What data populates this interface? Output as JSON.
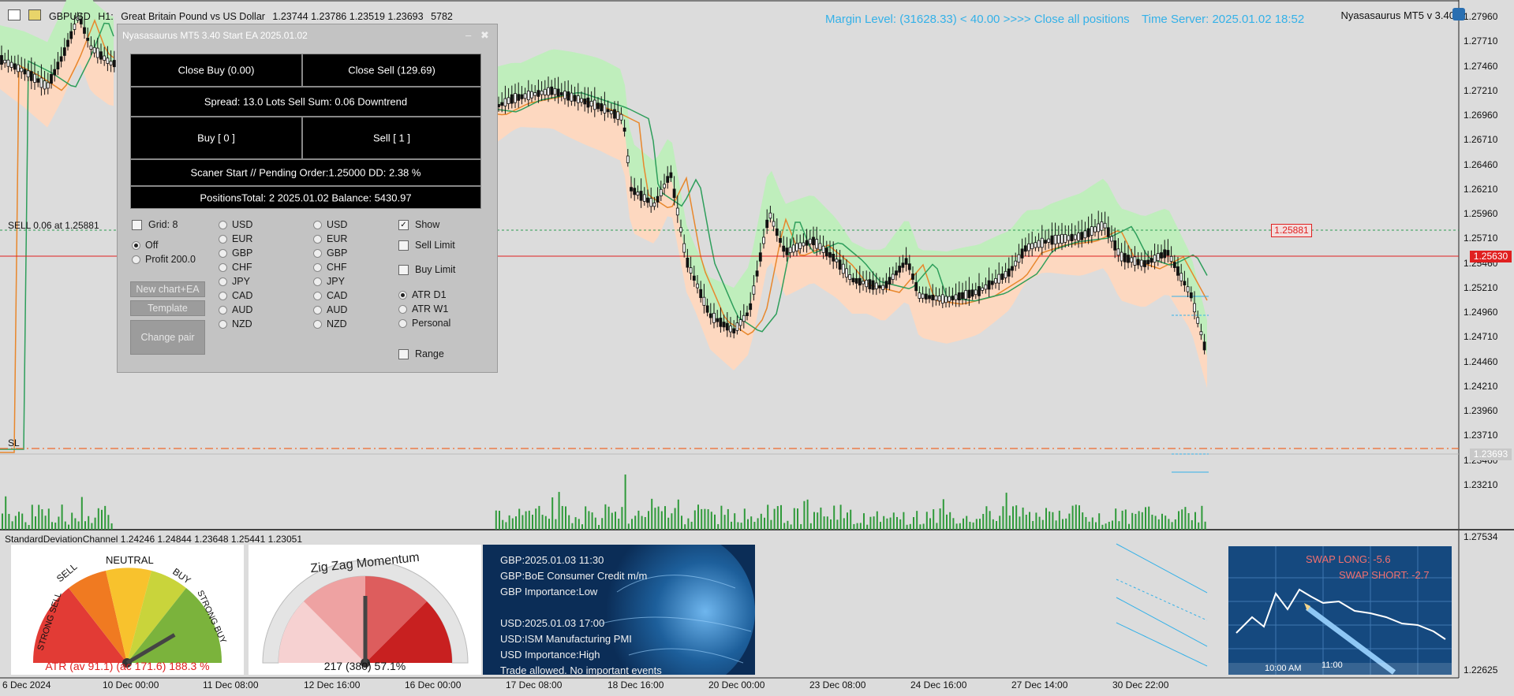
{
  "header": {
    "symbol": "GBPUSD",
    "timeframe": "H1:",
    "description": "Great Britain Pound vs US Dollar",
    "prices": "1.23744 1.23786 1.23519 1.23693",
    "tick_volume": "5782",
    "margin_text": "Margin Level: (31628.33) < 40.00 >>>> Close all positions",
    "time_server": "Time Server: 2025.01.02 18:52",
    "version": "Nyasasaurus MT5 v 3.40"
  },
  "price_axis": [
    "1.27960",
    "1.27710",
    "1.27460",
    "1.27210",
    "1.26960",
    "1.26710",
    "1.26460",
    "1.26210",
    "1.25960",
    "1.25710",
    "1.25460",
    "1.25210",
    "1.24960",
    "1.24710",
    "1.24460",
    "1.24210",
    "1.23960",
    "1.23710",
    "1.23460",
    "1.23210"
  ],
  "price_tags": {
    "sell_entry": "1.25881",
    "current_line": "1.25630",
    "bid": "1.23693"
  },
  "subwindow_axis": {
    "top": "1.27534",
    "bottom": "1.22625"
  },
  "date_axis": [
    "6 Dec 2024",
    "10 Dec 00:00",
    "11 Dec 08:00",
    "12 Dec 16:00",
    "16 Dec 00:00",
    "17 Dec 08:00",
    "18 Dec 16:00",
    "20 Dec 00:00",
    "23 Dec 08:00",
    "24 Dec 16:00",
    "27 Dec 14:00",
    "30 Dec 22:00"
  ],
  "chart_labels": {
    "sell_line": "SELL 0.06 at 1.25881",
    "sl_line": "SL"
  },
  "panel": {
    "title": "Nyasasaurus MT5 3.40  Start EA  2025.01.02",
    "minimize": "–",
    "close": "✖",
    "close_buy": "Close Buy (0.00)",
    "close_sell": "Close Sell (129.69)",
    "spread": "Spread: 13.0 Lots Sell Sum: 0.06 Downtrend",
    "buy": "Buy [ 0 ]",
    "sell": "Sell [ 1 ]",
    "scanner": "Scaner Start // Pending Order:1.25000 DD: 2.38 %",
    "positions": "PositionsTotal: 2   2025.01.02   Balance: 5430.97",
    "grid": "Grid: 8",
    "off": "Off",
    "profit": "Profit 200.0",
    "currencies_a": [
      "USD",
      "EUR",
      "GBP",
      "CHF",
      "JPY",
      "CAD",
      "AUD",
      "NZD"
    ],
    "currencies_b": [
      "USD",
      "EUR",
      "GBP",
      "CHF",
      "JPY",
      "CAD",
      "AUD",
      "NZD"
    ],
    "show": "Show",
    "sell_limit": "Sell Limit",
    "buy_limit": "Buy Limit",
    "atr_d1": "ATR D1",
    "atr_w1": "ATR W1",
    "personal": "Personal",
    "range": "Range",
    "new_chart": "New chart+EA",
    "template": "Template",
    "change_pair": "Change pair",
    "checkmark": "✓"
  },
  "indicator": {
    "title": "StandardDeviationChannel 1.24246 1.24844 1.23648 1.25441 1.23051",
    "gauge1_labels": {
      "strong_sell": "STRONG SELL",
      "sell": "SELL",
      "neutral": "NEUTRAL",
      "buy": "BUY",
      "strong_buy": "STRONG BUY"
    },
    "gauge1_caption": "ATR (av 91.1) (ac 171.6) 188.3 %",
    "gauge1_fraction": 0.83,
    "gauge2_title": "Zig Zag Momentum",
    "gauge2_caption": "217 (380) 57.1%",
    "gauge2_fraction": 0.5
  },
  "news": [
    "GBP:2025.01.03 11:30",
    "GBP:BoE Consumer Credit m/m",
    "GBP Importance:Low",
    "",
    "USD:2025.01.03 17:00",
    "USD:ISM Manufacturing PMI",
    "USD Importance:High",
    "Trade allowed. No important events"
  ],
  "swap": {
    "long": "SWAP LONG: -5.6",
    "short": "SWAP SHORT: -2.7",
    "time1": "10:00 AM",
    "time2": "11:00"
  },
  "colors": {
    "green_band": "#bfeebc",
    "orange_band": "#fdd8c0",
    "ema": "#e8872c",
    "sma": "#2e9e5b",
    "sell_line": "#2e9a52",
    "price_line": "#e02020",
    "sl_line": "#ee6a2c",
    "cyan": "#34b1e8"
  }
}
